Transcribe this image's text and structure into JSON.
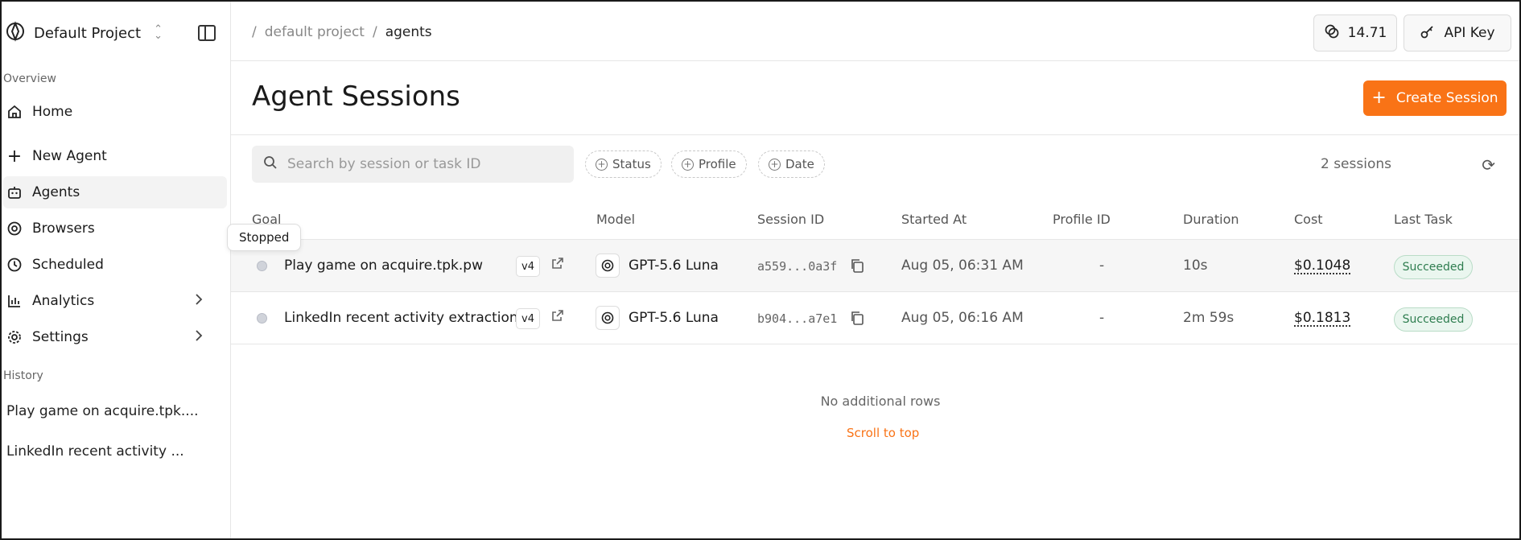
{
  "sidebar": {
    "project_name": "Default Project",
    "overview_label": "Overview",
    "items": [
      {
        "label": "Home"
      },
      {
        "label": "New Agent"
      },
      {
        "label": "Agents"
      },
      {
        "label": "Browsers"
      },
      {
        "label": "Scheduled"
      },
      {
        "label": "Analytics"
      },
      {
        "label": "Settings"
      }
    ],
    "history_label": "History",
    "history": [
      {
        "label": "Play game on acquire.tpk...."
      },
      {
        "label": "LinkedIn recent activity ..."
      }
    ]
  },
  "topbar": {
    "breadcrumb": [
      "default project",
      "agents"
    ],
    "credits": "14.71",
    "api_key_label": "API Key"
  },
  "header": {
    "title": "Agent Sessions",
    "create_label": "Create Session"
  },
  "filters": {
    "search_placeholder": "Search by session or task ID",
    "chips": [
      "Status",
      "Profile",
      "Date"
    ],
    "session_count": "2 sessions"
  },
  "table": {
    "columns": [
      "Goal",
      "Model",
      "Session ID",
      "Started At",
      "Profile ID",
      "Duration",
      "Cost",
      "Last Task"
    ],
    "rows": [
      {
        "goal": "Play game on acquire.tpk.pw",
        "version": "v4",
        "model": "GPT-5.6 Luna",
        "session_id": "a559...0a3f",
        "started_at": "Aug 05, 06:31 AM",
        "profile_id": "-",
        "duration": "10s",
        "cost": "$0.1048",
        "last_task": "Succeeded"
      },
      {
        "goal": "LinkedIn recent activity extraction",
        "version": "v4",
        "model": "GPT-5.6 Luna",
        "session_id": "b904...a7e1",
        "started_at": "Aug 05, 06:16 AM",
        "profile_id": "-",
        "duration": "2m 59s",
        "cost": "$0.1813",
        "last_task": "Succeeded"
      }
    ],
    "tooltip": "Stopped",
    "no_rows": "No additional rows",
    "scroll_top": "Scroll to top"
  },
  "colors": {
    "accent": "#f97316",
    "success_bg": "#eaf6ef",
    "success_text": "#2e7d4f"
  }
}
